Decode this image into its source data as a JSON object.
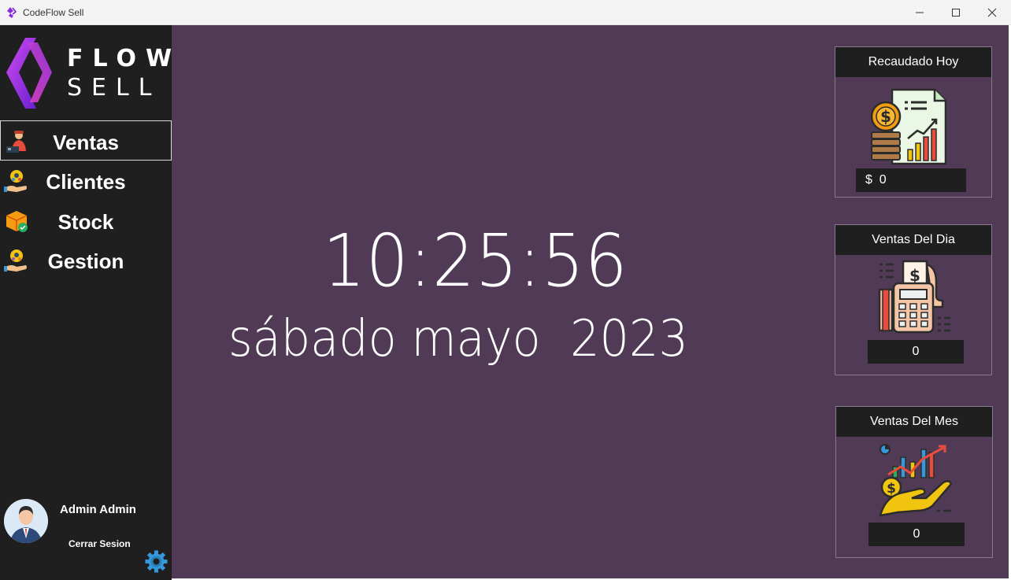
{
  "window": {
    "title": "CodeFlow Sell"
  },
  "logo": {
    "line1": "FLOW",
    "line2": "SELL"
  },
  "sidebar": {
    "items": [
      {
        "label": "Ventas",
        "icon": "salesperson-icon"
      },
      {
        "label": "Clientes",
        "icon": "clients-icon"
      },
      {
        "label": "Stock",
        "icon": "box-icon"
      },
      {
        "label": "Gestion",
        "icon": "management-icon"
      }
    ],
    "user_name": "Admin Admin",
    "logout_label": "Cerrar Sesion"
  },
  "main": {
    "time": "10:25:56",
    "date": "sábado mayo  2023"
  },
  "cards": {
    "recaudado": {
      "title": "Recaudado Hoy",
      "currency": "$",
      "value": "0"
    },
    "ventas_dia": {
      "title": "Ventas Del Dia",
      "value": "0"
    },
    "ventas_mes": {
      "title": "Ventas Del Mes",
      "value": "0"
    }
  },
  "colors": {
    "sidebar_bg": "#1f1f1f",
    "main_bg": "#513a56",
    "logo_gradient_start": "#b02ae0",
    "logo_gradient_end": "#6a1fd0"
  }
}
